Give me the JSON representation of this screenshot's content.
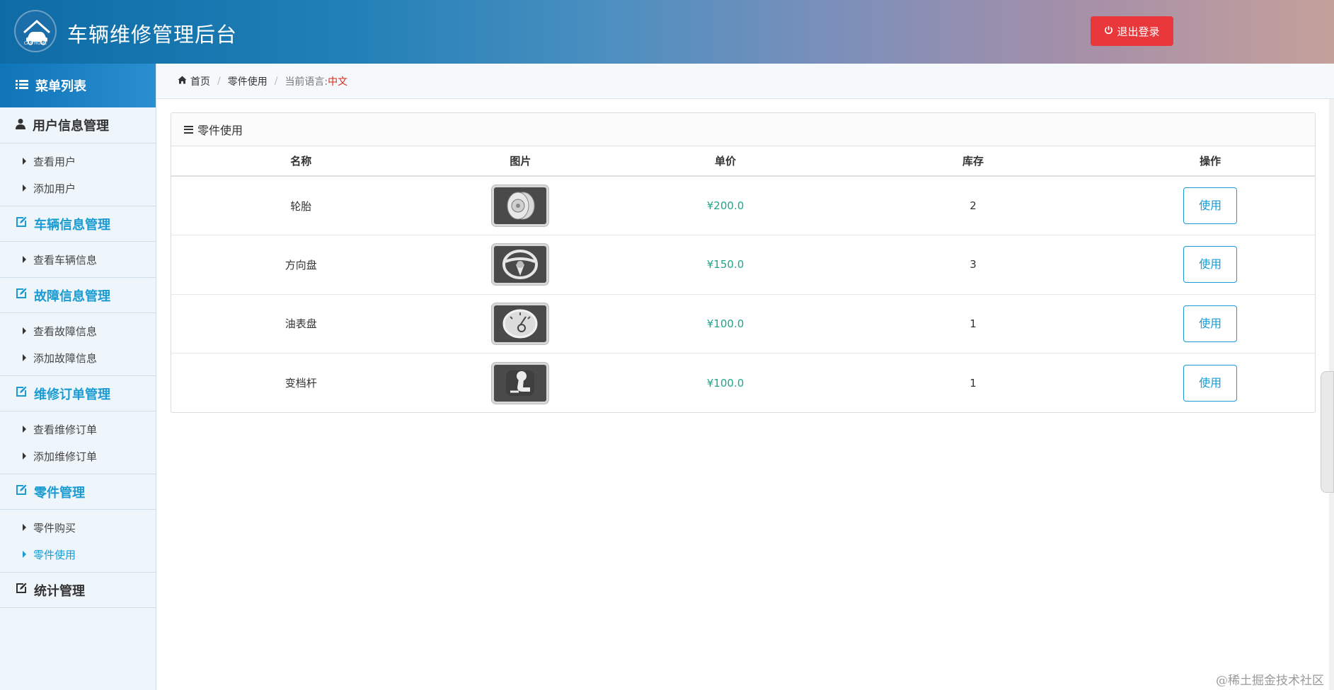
{
  "header": {
    "logo_text": "CAR HOME",
    "title": "车辆维修管理后台",
    "logout_label": "退出登录"
  },
  "sidebar": {
    "menu_title": "菜单列表",
    "groups": [
      {
        "label": "用户信息管理",
        "items": [
          "查看用户",
          "添加用户"
        ]
      },
      {
        "label": "车辆信息管理",
        "items": [
          "查看车辆信息"
        ]
      },
      {
        "label": "故障信息管理",
        "items": [
          "查看故障信息",
          "添加故障信息"
        ]
      },
      {
        "label": "维修订单管理",
        "items": [
          "查看维修订单",
          "添加维修订单"
        ]
      },
      {
        "label": "零件管理",
        "items": [
          "零件购买",
          "零件使用"
        ]
      },
      {
        "label": "统计管理",
        "items": []
      }
    ]
  },
  "breadcrumb": {
    "home": "首页",
    "current": "零件使用",
    "lang_label": "当前语言:",
    "lang_value": "中文"
  },
  "panel": {
    "title": "零件使用",
    "columns": [
      "名称",
      "图片",
      "单价",
      "库存",
      "操作"
    ],
    "rows": [
      {
        "name": "轮胎",
        "icon": "tire-icon",
        "price": "¥200.0",
        "stock": "2",
        "action": "使用"
      },
      {
        "name": "方向盘",
        "icon": "steering-wheel-icon",
        "price": "¥150.0",
        "stock": "3",
        "action": "使用"
      },
      {
        "name": "油表盘",
        "icon": "fuel-gauge-icon",
        "price": "¥100.0",
        "stock": "1",
        "action": "使用"
      },
      {
        "name": "变档杆",
        "icon": "gear-shift-icon",
        "price": "¥100.0",
        "stock": "1",
        "action": "使用"
      }
    ]
  },
  "watermark": "@稀土掘金技术社区",
  "colors": {
    "accent": "#1a9bd2",
    "logout": "#e8383b",
    "price": "#1fa58a",
    "lang": "#d42a1f"
  }
}
